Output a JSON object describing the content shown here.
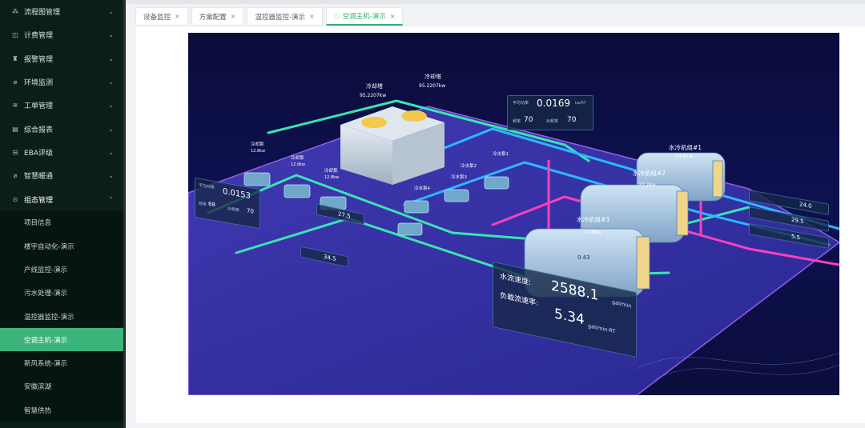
{
  "sidebar": {
    "items": [
      {
        "label": "流程图管理",
        "icon": "flow-chart-icon",
        "glyph": "⁂"
      },
      {
        "label": "计费管理",
        "icon": "billing-icon",
        "glyph": "◫"
      },
      {
        "label": "报警管理",
        "icon": "alarm-icon",
        "glyph": "♜"
      },
      {
        "label": "环境监测",
        "icon": "leaf-icon",
        "glyph": "⌀"
      },
      {
        "label": "工单管理",
        "icon": "layers-icon",
        "glyph": "≋"
      },
      {
        "label": "综合报表",
        "icon": "report-icon",
        "glyph": "▤"
      },
      {
        "label": "EBA评级",
        "icon": "rating-icon",
        "glyph": "⊟"
      },
      {
        "label": "智慧暖通",
        "icon": "hvac-icon",
        "glyph": "⌀"
      }
    ],
    "open_group": {
      "label": "组态管理",
      "icon": "config-icon",
      "glyph": "⊙",
      "children": [
        "项目信息",
        "楼宇自动化-演示",
        "产线监控-演示",
        "污水处理-演示",
        "温控器监控-演示",
        "空调主机-演示",
        "新风系统-演示",
        "安徽滨湖",
        "智慧供热"
      ],
      "active_index": 5
    }
  },
  "tabs": [
    {
      "label": "设备监控",
      "active": false
    },
    {
      "label": "方案配置",
      "active": false
    },
    {
      "label": "温控器监控-演示",
      "active": false
    },
    {
      "label": "空调主机-演示",
      "active": true
    }
  ],
  "colors": {
    "accent": "#2fae72",
    "sidebar_bg": "#0c1f17",
    "active_item": "#3bb47c"
  },
  "scene": {
    "cooling_tower_labels": [
      "冷却塔",
      "冷却塔"
    ],
    "cooling_tower_values": [
      "95.2207kw",
      "95.2207kw"
    ],
    "top_panel": {
      "rate_label": "平均功率",
      "rate_value": "0.0169",
      "unit": "kw/RT",
      "freq_label": "频率",
      "freq_value": "70",
      "ai_label": "AI频率",
      "ai_value": "70"
    },
    "left_panel": {
      "rate_label": "平均功率",
      "rate_value": "0.0153",
      "freq_label": "频率",
      "freq_value": "68",
      "ai_label": "AI频率",
      "ai_value": "70"
    },
    "pump_labels": [
      "冷却泵",
      "冷却泵",
      "冷却泵",
      "冷水泵1",
      "冷水泵2",
      "冷水泵3",
      "冷水泵4"
    ],
    "pump_power": [
      "12.8kw",
      "12.8kw",
      "12.8kw"
    ],
    "chiller_labels": [
      "水冷机组#1",
      "水冷机组#2",
      "水冷机组#3"
    ],
    "chiller_power": [
      "14.8kw",
      "27.2kw",
      "12.8kw"
    ],
    "chiller_cop": "0.43",
    "left_readouts": [
      "27.5",
      "34.5"
    ],
    "right_readouts": [
      "24.0",
      "29.5",
      "5.5"
    ],
    "flow": {
      "label1": "水流速度:",
      "value1": "2588.1",
      "unit1": "gal/min",
      "label2": "负载流速率:",
      "value2": "5.34",
      "unit2": "gal/min·RT"
    }
  }
}
